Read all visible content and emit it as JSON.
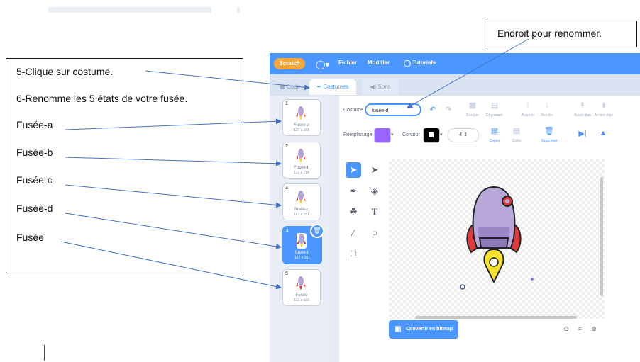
{
  "instructions": {
    "lines": [
      "5-Clique sur costume.",
      "6-Renomme les 5 états de votre fusée.",
      "Fusée-a",
      "Fusée-b",
      "Fusée-c",
      "Fusée-d",
      "Fusée"
    ]
  },
  "callout": {
    "text": "Endroit pour renommer."
  },
  "app": {
    "logo": "Scratch",
    "menu": {
      "file": "Fichier",
      "edit": "Modifier",
      "tutorials": "Tutoriels"
    },
    "tabs": {
      "code": "Code",
      "costumes": "Costumes",
      "sounds": "Sons"
    },
    "costumes": [
      {
        "num": "1",
        "name": "Fusée-a",
        "size": "127 x 161"
      },
      {
        "num": "2",
        "name": "Fusée-b",
        "size": "113 x 214"
      },
      {
        "num": "3",
        "name": "fusée-c",
        "size": "127 x 161"
      },
      {
        "num": "4",
        "name": "fusée-d",
        "size": "127 x 161"
      },
      {
        "num": "5",
        "name": "Fusée",
        "size": "119 x 132"
      }
    ],
    "toolbar": {
      "costume_label": "Costume",
      "costume_value": "fusée-d",
      "group": "Grouper",
      "ungroup": "Dégrouper",
      "forward": "Avancer",
      "backward": "Reculer",
      "front": "Avant-plan",
      "back": "Arrière-plan",
      "fill_label": "Remplissage",
      "outline_label": "Contour",
      "outline_width": "4",
      "copy": "Copier",
      "paste": "Coller",
      "delete": "Supprimer"
    },
    "convert_bitmap": "Convertir en bitmap",
    "zoom_reset": "="
  },
  "colors": {
    "accent": "#4c97ff",
    "fill": "#9966ff",
    "outline": "#000000",
    "topbar": "#4c97ff"
  }
}
